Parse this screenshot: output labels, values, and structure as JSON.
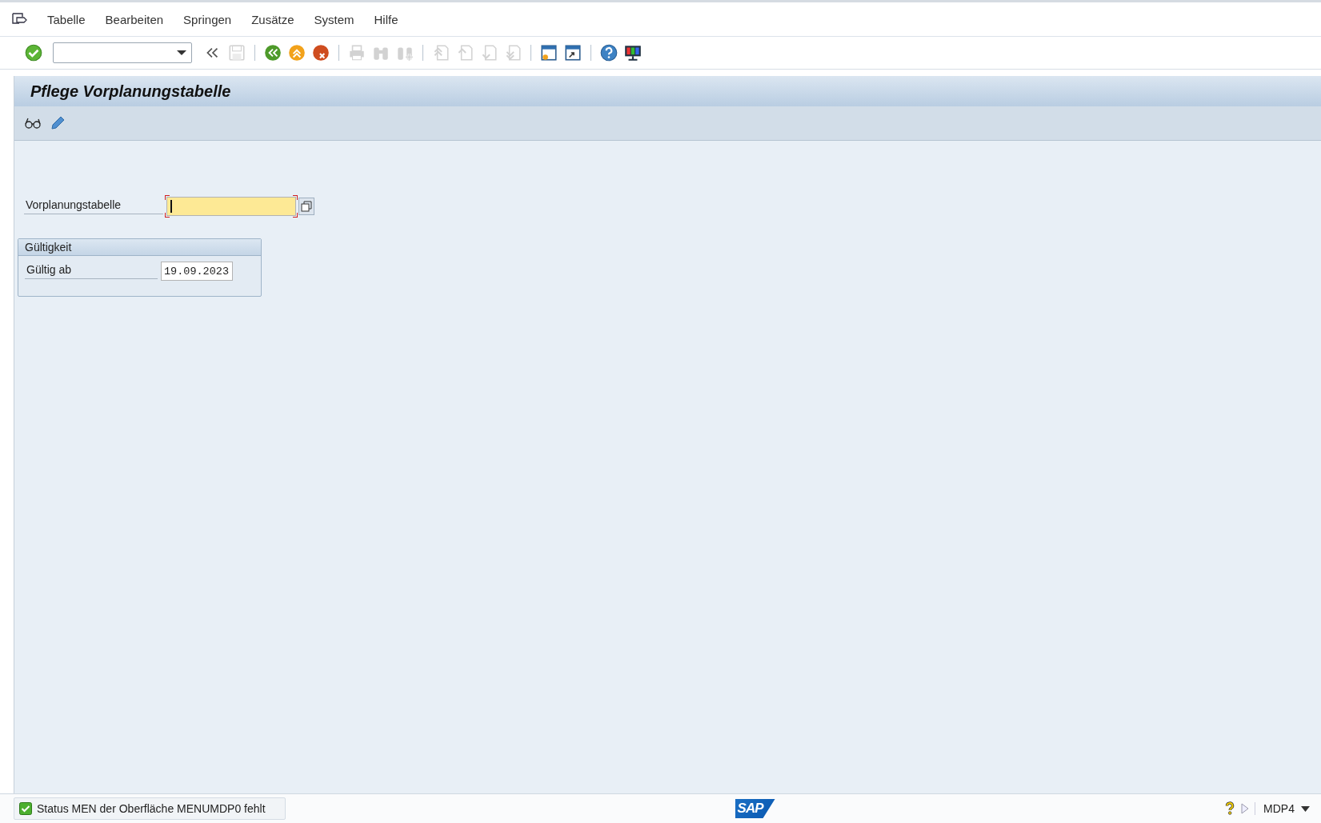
{
  "menu": [
    {
      "label": "Tabelle"
    },
    {
      "label": "Bearbeiten"
    },
    {
      "label": "Springen"
    },
    {
      "label": "Zusätze"
    },
    {
      "label": "System"
    },
    {
      "label": "Hilfe"
    }
  ],
  "toolbar": [
    {
      "kind": "enter",
      "disabled": false
    },
    {
      "kind": "command"
    },
    {
      "kind": "collapse",
      "disabled": false
    },
    {
      "kind": "save",
      "disabled": true
    },
    {
      "kind": "separator"
    },
    {
      "kind": "back",
      "disabled": false
    },
    {
      "kind": "exit",
      "disabled": false
    },
    {
      "kind": "cancel",
      "disabled": false
    },
    {
      "kind": "separator"
    },
    {
      "kind": "print",
      "disabled": true
    },
    {
      "kind": "find",
      "disabled": true
    },
    {
      "kind": "find-next",
      "disabled": true
    },
    {
      "kind": "separator"
    },
    {
      "kind": "first-page",
      "disabled": true
    },
    {
      "kind": "previous-page",
      "disabled": true
    },
    {
      "kind": "next-page",
      "disabled": true
    },
    {
      "kind": "last-page",
      "disabled": true
    },
    {
      "kind": "separator"
    },
    {
      "kind": "new-session",
      "disabled": false
    },
    {
      "kind": "shortcut",
      "disabled": false
    },
    {
      "kind": "separator"
    },
    {
      "kind": "help",
      "disabled": false
    },
    {
      "kind": "layout",
      "disabled": false
    }
  ],
  "title": "Pflege Vorplanungstabelle",
  "app_toolbar": [
    {
      "kind": "display"
    },
    {
      "kind": "change"
    }
  ],
  "field": {
    "label": "Vorplanungstabelle",
    "focused": true
  },
  "group": {
    "title": "Gültigkeit",
    "fields": [
      {
        "label": "Gültig ab",
        "value": "19.09.2023"
      }
    ]
  },
  "status_bar": {
    "message": "Status MEN der Oberfläche MENUMDP0 fehlt",
    "logo": "SAP",
    "system": "MDP4"
  }
}
